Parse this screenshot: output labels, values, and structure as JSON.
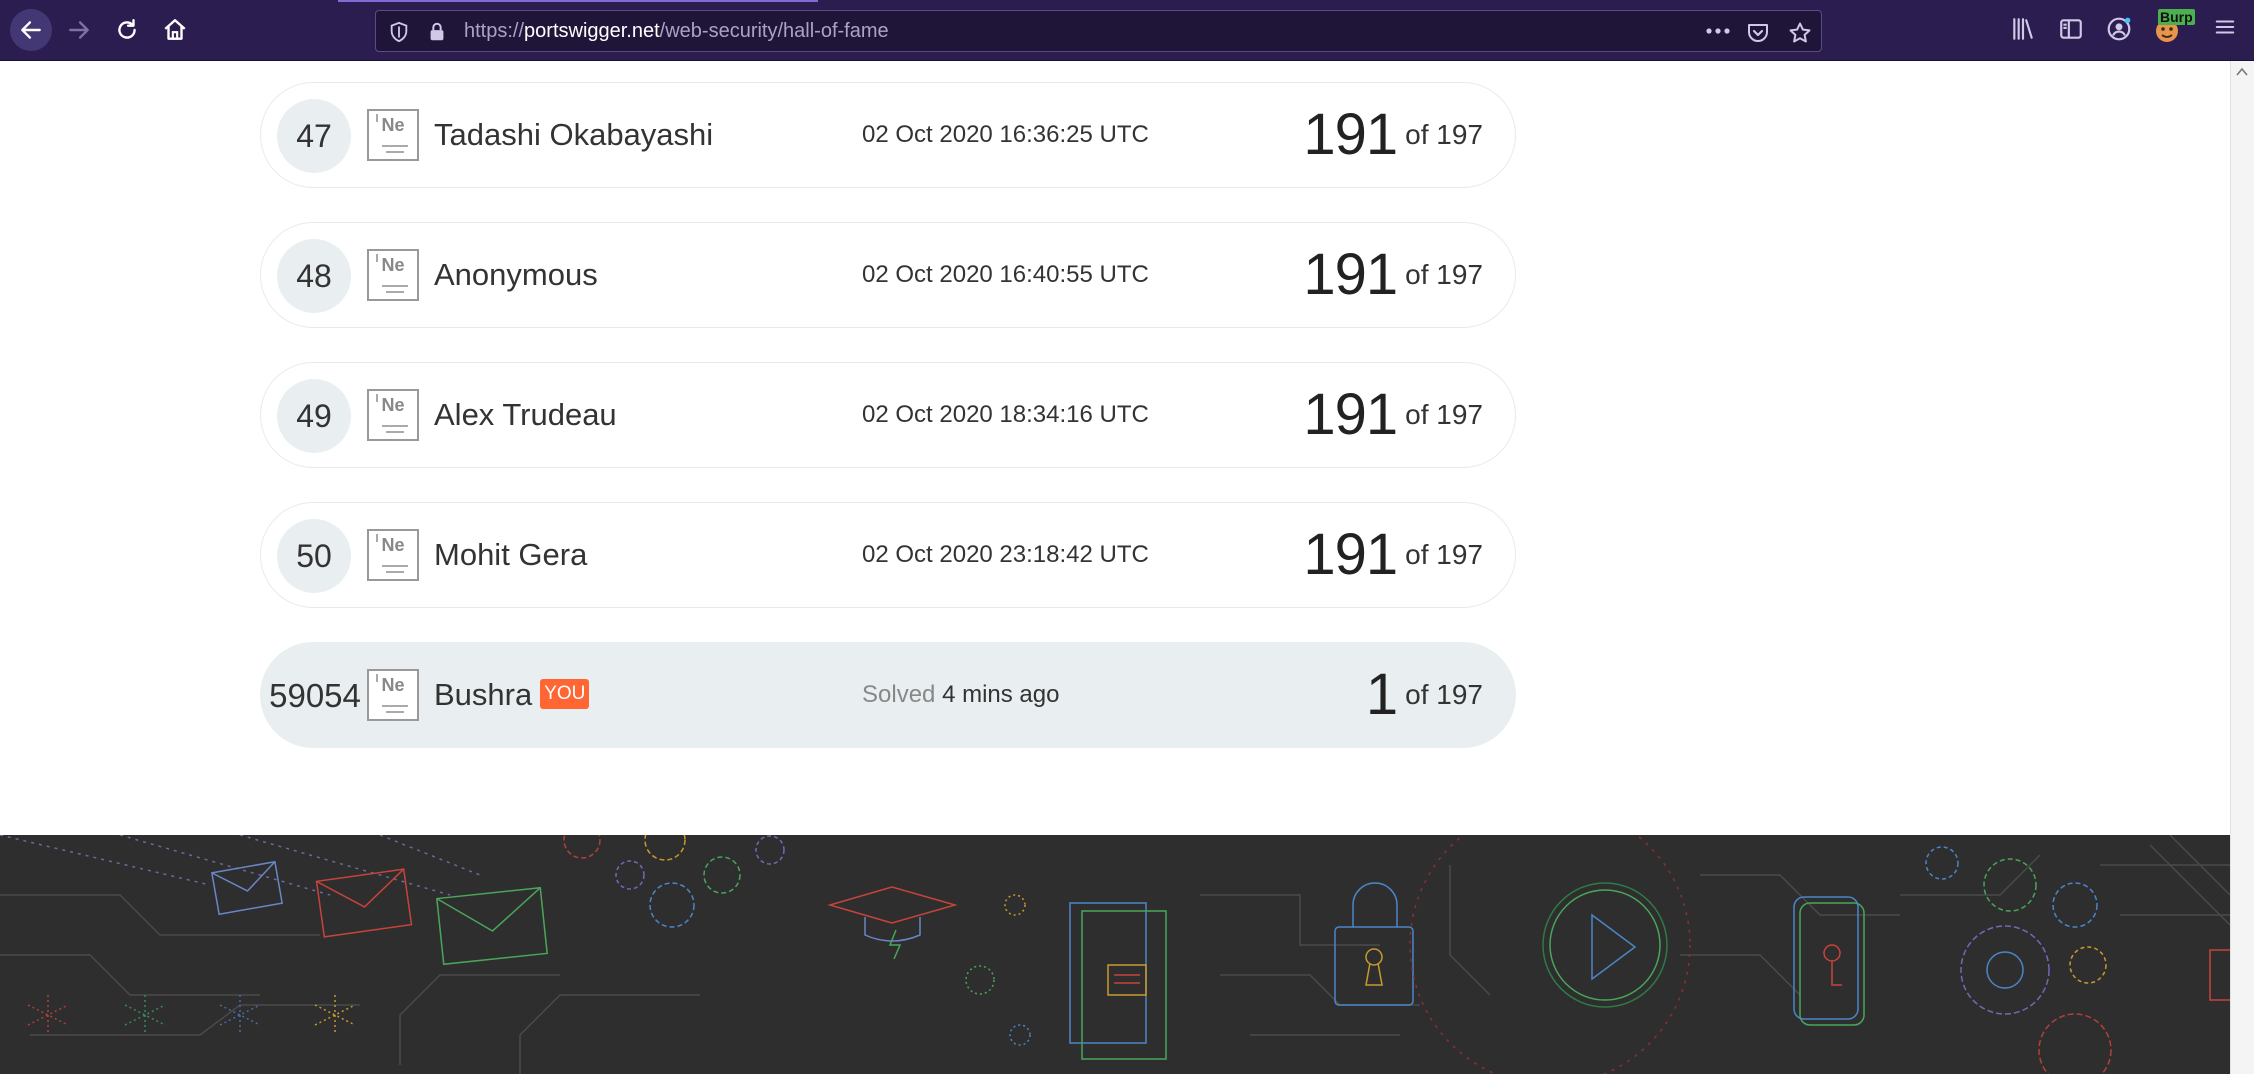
{
  "browser": {
    "url_scheme": "https://",
    "url_domain": "portswigger.net",
    "url_path": "/web-security/hall-of-fame",
    "burp_label": "Burp"
  },
  "leaderboard": {
    "rows": [
      {
        "rank": "47",
        "badge": "Ne",
        "name": "Tadashi Okabayashi",
        "timestamp": "02 Oct 2020 16:36:25 UTC",
        "score": "191",
        "total": "of 197"
      },
      {
        "rank": "48",
        "badge": "Ne",
        "name": "Anonymous",
        "timestamp": "02 Oct 2020 16:40:55 UTC",
        "score": "191",
        "total": "of 197"
      },
      {
        "rank": "49",
        "badge": "Ne",
        "name": "Alex Trudeau",
        "timestamp": "02 Oct 2020 18:34:16 UTC",
        "score": "191",
        "total": "of 197"
      },
      {
        "rank": "50",
        "badge": "Ne",
        "name": "Mohit Gera",
        "timestamp": "02 Oct 2020 23:18:42 UTC",
        "score": "191",
        "total": "of 197"
      }
    ],
    "current_user": {
      "rank": "59054",
      "badge": "Ne",
      "name": "Bushra",
      "you_tag": "YOU",
      "solved_label": "Solved",
      "solved_ago": "4 mins ago",
      "score": "1",
      "total": "of 197"
    }
  },
  "colors": {
    "chrome_bg": "#2b1d4f",
    "you_tag": "#ff6633",
    "row_highlight": "#e9eef1",
    "footer_bg": "#2e2e2e"
  }
}
